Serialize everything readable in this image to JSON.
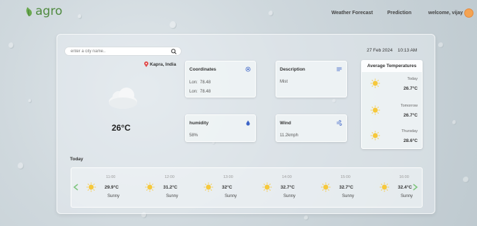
{
  "nav": {
    "logo_text": "agro",
    "links": [
      "Weather Forecast",
      "Prediction"
    ],
    "welcome": "welcome, vijay"
  },
  "search": {
    "placeholder": "enter a city name..",
    "value": ""
  },
  "location": "Kapra, India",
  "current": {
    "temperature": "26°C",
    "icon": "cloud-icon"
  },
  "coordinates": {
    "title": "Coordinates",
    "lon_label": "Lon:",
    "lon_value": "78.48",
    "lat_label": "Lon:",
    "lat_value": "78.48"
  },
  "description": {
    "title": "Description",
    "value": "Mist"
  },
  "humidity": {
    "title": "humidity",
    "value": "58%"
  },
  "wind": {
    "title": "Wind",
    "value": "11.2kmph"
  },
  "datetime": "27 Feb 2024    10:13 AM",
  "avg_temps": {
    "title": "Average Temperatures",
    "items": [
      {
        "day": "Today",
        "temp": "26.7°C"
      },
      {
        "day": "Tomorrow",
        "temp": "26.7°C"
      },
      {
        "day": "Thursday",
        "temp": "28.6°C"
      }
    ]
  },
  "hourly": {
    "title": "Today",
    "items": [
      {
        "time": "11:00",
        "temp": "29.9°C",
        "condition": "Sunny"
      },
      {
        "time": "12:00",
        "temp": "31.2°C",
        "condition": "Sunny"
      },
      {
        "time": "13:00",
        "temp": "32°C",
        "condition": "Sunny"
      },
      {
        "time": "14:00",
        "temp": "32.7°C",
        "condition": "Sunny"
      },
      {
        "time": "15:00",
        "temp": "32.7°C",
        "condition": "Sunny"
      },
      {
        "time": "16:00",
        "temp": "32.4°C",
        "condition": "Sunny"
      }
    ]
  },
  "colors": {
    "accent": "#4f8a3f",
    "sun": "#f6c83b",
    "avatar": "#f4a352",
    "arrows": "#7cc47b"
  }
}
